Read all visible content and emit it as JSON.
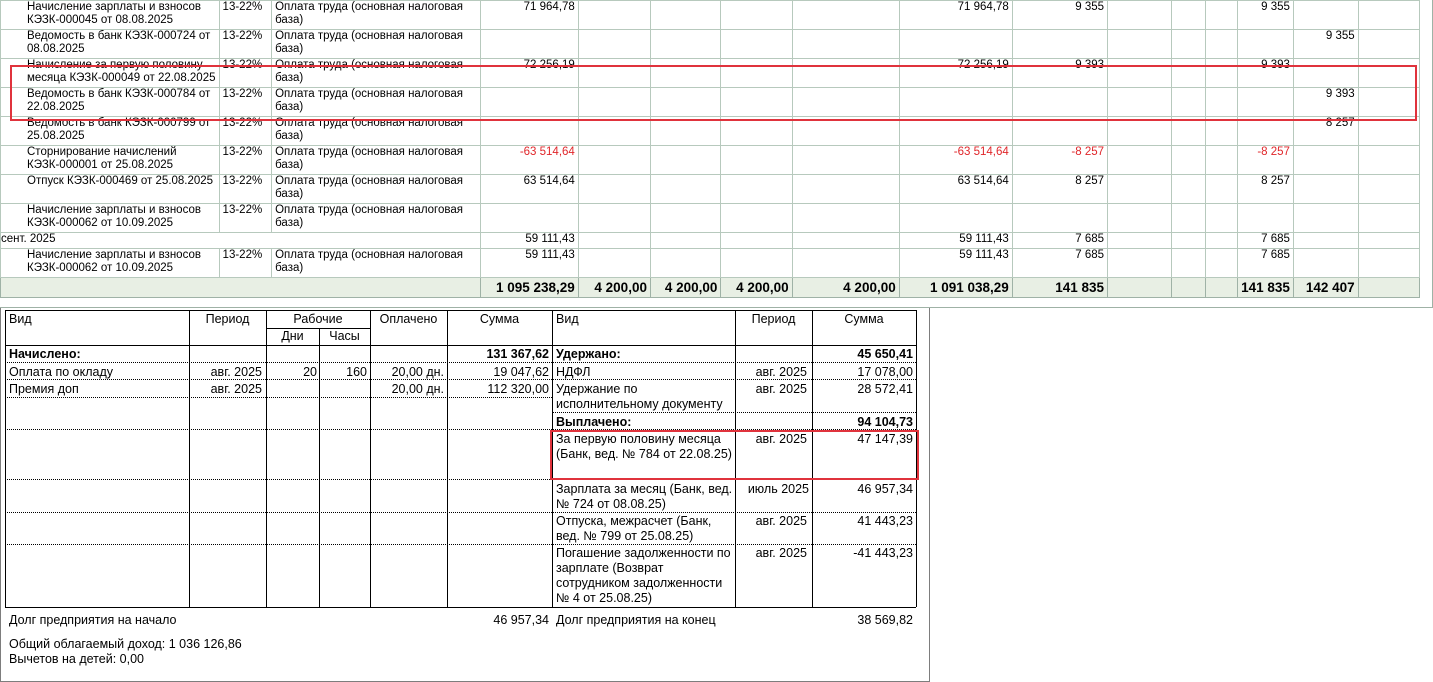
{
  "register": {
    "rows": [
      {
        "name": "Начисление зарплаты и взносов КЭЗК-000045 от 08.08.2025",
        "rate": "13-22%",
        "type": "Оплата труда (основная налоговая база)",
        "c1": "71 964,78",
        "c2": "",
        "c3": "",
        "c4": "",
        "c5": "",
        "c6": "71 964,78",
        "c7": "9 355",
        "c8": "",
        "c9": "",
        "c10": "",
        "c11": "9 355",
        "c12": "",
        "neg": false
      },
      {
        "name": "Ведомость в банк КЭЗК-000724 от 08.08.2025",
        "rate": "13-22%",
        "type": "Оплата труда (основная налоговая база)",
        "c1": "",
        "c2": "",
        "c3": "",
        "c4": "",
        "c5": "",
        "c6": "",
        "c7": "",
        "c8": "",
        "c9": "",
        "c10": "",
        "c11": "",
        "c12": "9 355",
        "neg": false
      },
      {
        "name": "Начисление за первую половину месяца КЭЗК-000049 от 22.08.2025",
        "rate": "13-22%",
        "type": "Оплата труда (основная налоговая база)",
        "c1": "72 256,19",
        "c2": "",
        "c3": "",
        "c4": "",
        "c5": "",
        "c6": "72 256,19",
        "c7": "9 393",
        "c8": "",
        "c9": "",
        "c10": "",
        "c11": "9 393",
        "c12": "",
        "neg": false
      },
      {
        "name": "Ведомость в банк КЭЗК-000784 от 22.08.2025",
        "rate": "13-22%",
        "type": "Оплата труда (основная налоговая база)",
        "c1": "",
        "c2": "",
        "c3": "",
        "c4": "",
        "c5": "",
        "c6": "",
        "c7": "",
        "c8": "",
        "c9": "",
        "c10": "",
        "c11": "",
        "c12": "9 393",
        "neg": false
      },
      {
        "name": "Ведомость в банк КЭЗК-000799 от 25.08.2025",
        "rate": "13-22%",
        "type": "Оплата труда (основная налоговая база)",
        "c1": "",
        "c2": "",
        "c3": "",
        "c4": "",
        "c5": "",
        "c6": "",
        "c7": "",
        "c8": "",
        "c9": "",
        "c10": "",
        "c11": "",
        "c12": "8 257",
        "neg": false
      },
      {
        "name": "Сторнирование начислений КЭЗК-000001 от 25.08.2025",
        "rate": "13-22%",
        "type": "Оплата труда (основная налоговая база)",
        "c1": "-63 514,64",
        "c2": "",
        "c3": "",
        "c4": "",
        "c5": "",
        "c6": "-63 514,64",
        "c7": "-8 257",
        "c8": "",
        "c9": "",
        "c10": "",
        "c11": "-8 257",
        "c12": "",
        "neg": true
      },
      {
        "name": "Отпуск КЭЗК-000469 от 25.08.2025",
        "rate": "13-22%",
        "type": "Оплата труда (основная налоговая база)",
        "c1": "63 514,64",
        "c2": "",
        "c3": "",
        "c4": "",
        "c5": "",
        "c6": "63 514,64",
        "c7": "8 257",
        "c8": "",
        "c9": "",
        "c10": "",
        "c11": "8 257",
        "c12": "",
        "neg": false
      },
      {
        "name": "Начисление зарплаты и взносов КЭЗК-000062 от 10.09.2025",
        "rate": "13-22%",
        "type": "Оплата труда (основная налоговая база)",
        "c1": "",
        "c2": "",
        "c3": "",
        "c4": "",
        "c5": "",
        "c6": "",
        "c7": "",
        "c8": "",
        "c9": "",
        "c10": "",
        "c11": "",
        "c12": "",
        "neg": false
      }
    ],
    "month": {
      "label": "сент. 2025",
      "c1": "59 111,43",
      "c6": "59 111,43",
      "c7": "7 685",
      "c11": "7 685"
    },
    "last_row": {
      "name": "Начисление зарплаты и взносов КЭЗК-000062 от 10.09.2025",
      "rate": "13-22%",
      "type": "Оплата труда (основная налоговая база)",
      "c1": "59 111,43",
      "c6": "59 111,43",
      "c7": "7 685",
      "c11": "7 685"
    },
    "totals": {
      "c1": "1 095 238,29",
      "c2": "4 200,00",
      "c3": "4 200,00",
      "c4": "4 200,00",
      "c5": "4 200,00",
      "c6": "1 091 038,29",
      "c7": "141 835",
      "c8": "",
      "c9": "",
      "c10": "",
      "c11": "141 835",
      "c12": "142 407"
    }
  },
  "slip": {
    "headers": {
      "vid": "Вид",
      "period": "Период",
      "work": "Рабочие",
      "days": "Дни",
      "hours": "Часы",
      "paid": "Оплачено",
      "sum": "Сумма",
      "vid2": "Вид",
      "period2": "Период",
      "sum2": "Сумма"
    },
    "accrued": {
      "label": "Начислено:",
      "total": "131 367,62"
    },
    "accruals": [
      {
        "name": "Оплата по окладу",
        "period": "авг. 2025",
        "days": "20",
        "hours": "160",
        "paid": "20,00 дн.",
        "sum": "19 047,62"
      },
      {
        "name": "Премия доп",
        "period": "авг. 2025",
        "days": "",
        "hours": "",
        "paid": "20,00 дн.",
        "sum": "112 320,00"
      }
    ],
    "withheld": {
      "label": "Удержано:",
      "total": "45 650,41"
    },
    "withholdings": [
      {
        "name": "НДФЛ",
        "period": "авг. 2025",
        "sum": "17 078,00"
      },
      {
        "name": "Удержание по исполнительному документу",
        "period": "авг. 2025",
        "sum": "28 572,41"
      }
    ],
    "paid_out": {
      "label": "Выплачено:",
      "total": "94 104,73"
    },
    "payments": [
      {
        "name": "За первую половину месяца (Банк, вед. № 784 от 22.08.25)",
        "period": "авг. 2025",
        "sum": "47 147,39"
      },
      {
        "name": "Зарплата за месяц (Банк, вед. № 724 от 08.08.25)",
        "period": "июль 2025",
        "sum": "46 957,34"
      },
      {
        "name": "Отпуска, межрасчет (Банк, вед. № 799 от 25.08.25)",
        "period": "авг. 2025",
        "sum": "41 443,23"
      },
      {
        "name": "Погашение задолженности по зарплате (Возврат сотрудником задолженности № 4 от 25.08.25)",
        "period": "авг. 2025",
        "sum": "-41 443,23"
      }
    ],
    "debt_start": {
      "label": "Долг предприятия на начало",
      "value": "46 957,34"
    },
    "debt_end": {
      "label": "Долг предприятия на конец",
      "value": "38 569,82"
    },
    "taxable_income": "Общий облагаемый доход: 1 036 126,86",
    "child_deductions": "Вычетов на детей: 0,00"
  },
  "colors": {
    "highlight": "#e0333c",
    "negative": "#e0262a",
    "total_bg": "#e8efe4",
    "grid": "#b7c9bd"
  }
}
